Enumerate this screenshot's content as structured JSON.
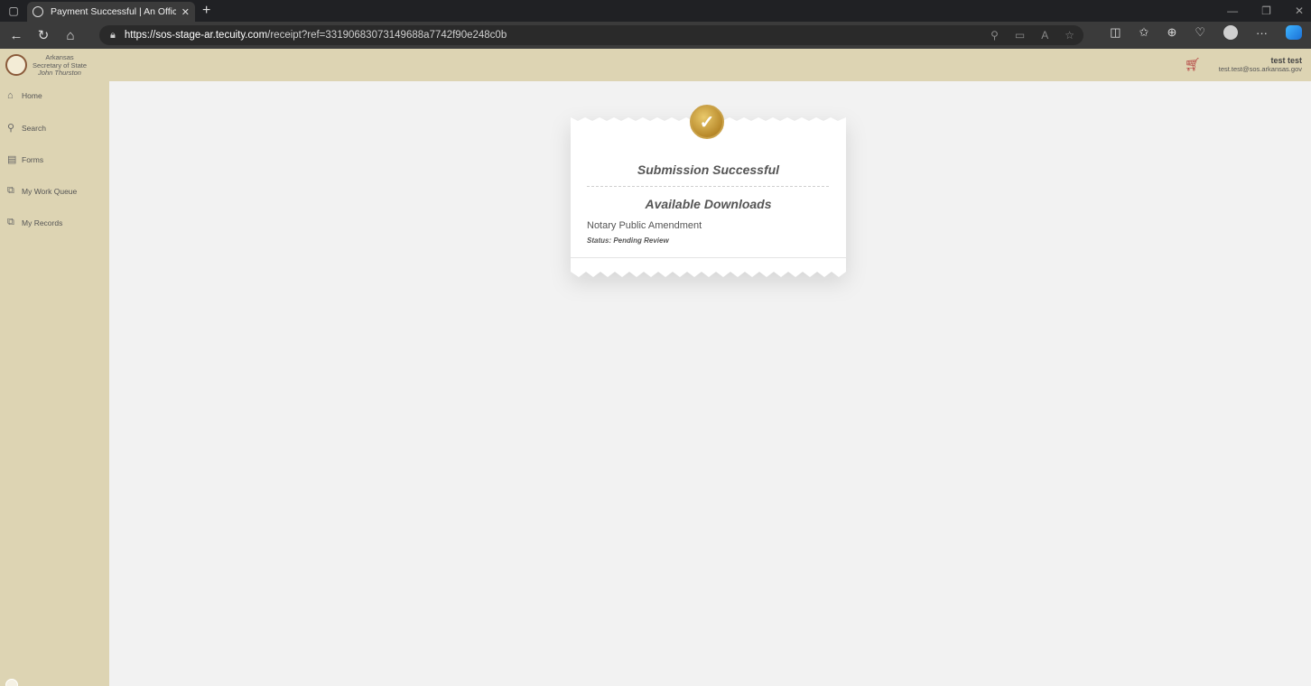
{
  "browser": {
    "tab_title": "Payment Successful | An Official",
    "url_host": "https://sos-stage-ar.tecuity.com",
    "url_path": "/receipt?ref=33190683073149688a7742f90e248c0b"
  },
  "header": {
    "brand_line1": "Arkansas",
    "brand_line2": "Secretary of State",
    "brand_line3": "John Thurston",
    "user_name": "test test",
    "user_email": "test.test@sos.arkansas.gov"
  },
  "sidebar": {
    "items": [
      {
        "label": "Home",
        "icon": "home-icon"
      },
      {
        "label": "Search",
        "icon": "search-icon"
      },
      {
        "label": "Forms",
        "icon": "forms-icon"
      },
      {
        "label": "My Work Queue",
        "icon": "work-queue-icon"
      },
      {
        "label": "My Records",
        "icon": "records-icon"
      }
    ]
  },
  "receipt": {
    "title": "Submission Successful",
    "downloads_title": "Available Downloads",
    "document_name": "Notary Public Amendment",
    "document_status": "Status: Pending Review"
  },
  "colors": {
    "sidebar_bg": "#ddd4b3",
    "badge_gold": "#c9a13b"
  }
}
